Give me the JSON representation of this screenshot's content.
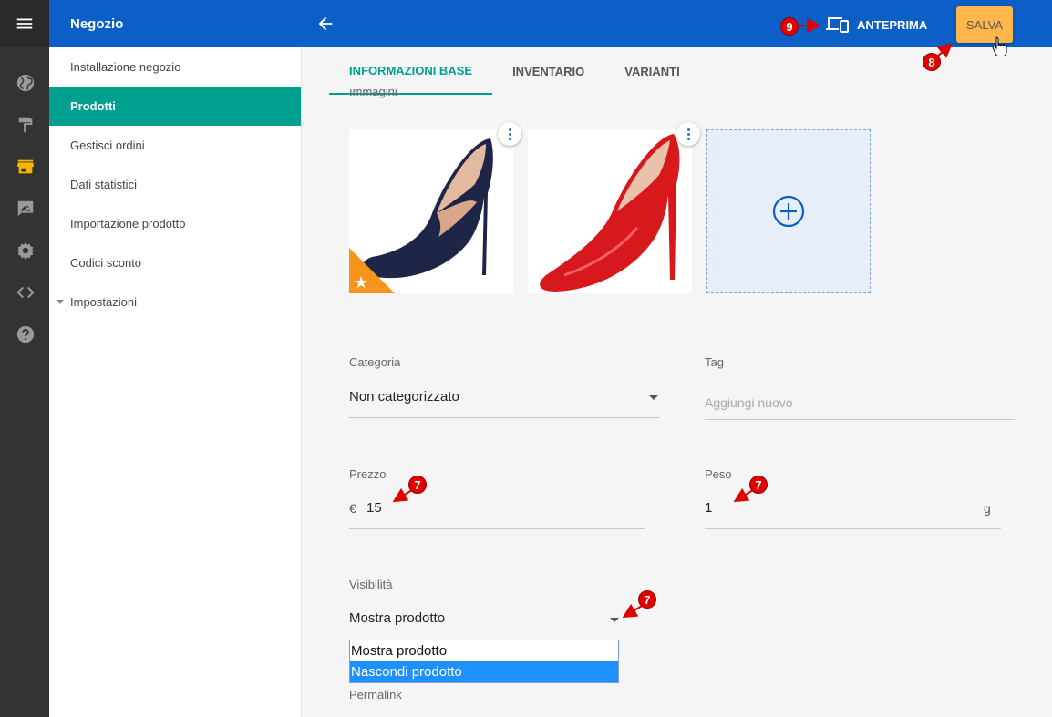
{
  "app": {
    "title": "Negozio"
  },
  "rail": {
    "icons": [
      "menu-icon",
      "globe-icon",
      "paint-roller-icon",
      "store-icon",
      "feedback-icon",
      "gear-icon",
      "code-icon",
      "help-icon"
    ],
    "active_color": "#f7b500"
  },
  "header": {
    "preview_label": "ANTEPRIMA",
    "save_label": "SALVA"
  },
  "sidebar": {
    "items": [
      {
        "label": "Installazione negozio"
      },
      {
        "label": "Prodotti"
      },
      {
        "label": "Gestisci ordini"
      },
      {
        "label": "Dati statistici"
      },
      {
        "label": "Importazione prodotto"
      },
      {
        "label": "Codici sconto"
      },
      {
        "label": "Impostazioni"
      }
    ],
    "active_index": 1
  },
  "tabs": [
    {
      "label": "INFORMAZIONI BASE"
    },
    {
      "label": "INVENTARIO"
    },
    {
      "label": "VARIANTI"
    }
  ],
  "images_section": {
    "label": "Immagini"
  },
  "form": {
    "category": {
      "label": "Categoria",
      "value": "Non categorizzato"
    },
    "tag": {
      "label": "Tag",
      "placeholder": "Aggiungi nuovo"
    },
    "price": {
      "label": "Prezzo",
      "currency": "€",
      "value": "15"
    },
    "weight": {
      "label": "Peso",
      "value": "1",
      "unit": "g"
    },
    "visibility": {
      "label": "Visibilità",
      "value": "Mostra prodotto",
      "options": [
        "Mostra prodotto",
        "Nascondi prodotto"
      ]
    },
    "permalink": {
      "label": "Permalink"
    }
  },
  "annotations": {
    "badges": [
      "9",
      "8",
      "7",
      "7",
      "7"
    ],
    "color": "#e00000"
  },
  "colors": {
    "topbar": "#0b5fc7",
    "accent": "#00a090",
    "save_button": "#ffb74d",
    "featured_star": "#f7941d"
  }
}
